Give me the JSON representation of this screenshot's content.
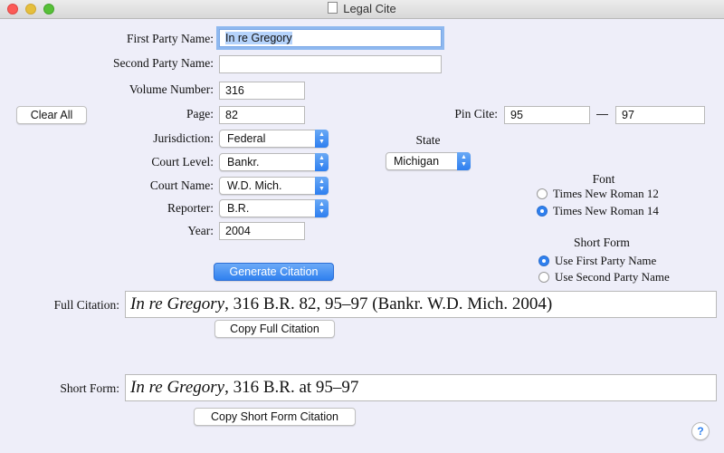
{
  "window": {
    "title": "Legal Cite",
    "traffic_colors": {
      "close": "#fc5b57",
      "minimize": "#e5bf3c",
      "zoom": "#57c038"
    }
  },
  "form": {
    "first_party": {
      "label": "First Party Name:",
      "value": "In re Gregory"
    },
    "second_party": {
      "label": "Second Party Name:",
      "value": ""
    },
    "volume": {
      "label": "Volume Number:",
      "value": "316"
    },
    "page": {
      "label": "Page:",
      "value": "82"
    },
    "pin_cite": {
      "label": "Pin Cite:",
      "from": "95",
      "dash": "—",
      "to": "97"
    },
    "jurisdiction": {
      "label": "Jurisdiction:",
      "value": "Federal"
    },
    "court_level": {
      "label": "Court Level:",
      "value": "Bankr."
    },
    "court_name": {
      "label": "Court Name:",
      "value": "W.D. Mich."
    },
    "reporter": {
      "label": "Reporter:",
      "value": "B.R."
    },
    "year": {
      "label": "Year:",
      "value": "2004"
    },
    "state": {
      "label": "State",
      "value": "Michigan"
    }
  },
  "buttons": {
    "clear_all": "Clear All",
    "generate": "Generate Citation",
    "copy_full": "Copy Full Citation",
    "copy_short": "Copy Short Form Citation",
    "help": "?"
  },
  "font_group": {
    "title": "Font",
    "options": [
      {
        "label": "Times New Roman 12",
        "selected": false
      },
      {
        "label": "Times New Roman 14",
        "selected": true
      }
    ]
  },
  "short_form_group": {
    "title": "Short Form",
    "options": [
      {
        "label": "Use First Party Name",
        "selected": true
      },
      {
        "label": "Use Second Party Name",
        "selected": false
      }
    ]
  },
  "full_citation": {
    "label": "Full Citation:",
    "case_name": "In re Gregory",
    "rest": ", 316 B.R. 82, 95–97 (Bankr. W.D. Mich. 2004)"
  },
  "short_citation": {
    "label": "Short Form:",
    "case_name": "In re Gregory",
    "rest": ", 316 B.R. at 95–97"
  },
  "accent_color": "#2f80ef"
}
